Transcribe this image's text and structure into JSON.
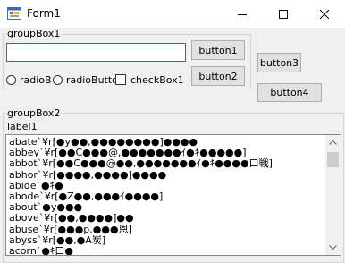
{
  "window": {
    "title": "Form1"
  },
  "groupBox1": {
    "title": "groupBox1",
    "textbox_value": "",
    "button1": "button1",
    "button2": "button2",
    "radio1": "radioB",
    "radio2": "radioButto",
    "checkbox": "checkBox1"
  },
  "button3": "button3",
  "button4": "button4",
  "groupBox2": {
    "title": "groupBox2",
    "label": "label1",
    "list": [
      "abate`¥r[●y●●,●●●●●●●●]●●●●",
      "abbey`¥r[●●C●●●@,●●●●●●●ｲ●ｷ●●●●●]",
      "abbot`¥r[●●C●●●@●●,●●●●●●●ｲ●ｷ●●●●口戦]",
      "abhor`¥r[●●●●,●●●●]●●●●",
      "abide`●ｷ●",
      "abode`¥r[●Z●●,●●●ｲ●●●●]",
      "about`●y●●●",
      "above`¥r[●●,●●●●]●●",
      "abuse`¥r[●●●p,●●●恩]",
      "abyss`¥r[●●,●A炭]",
      "acorn`●ｷ口●"
    ]
  }
}
